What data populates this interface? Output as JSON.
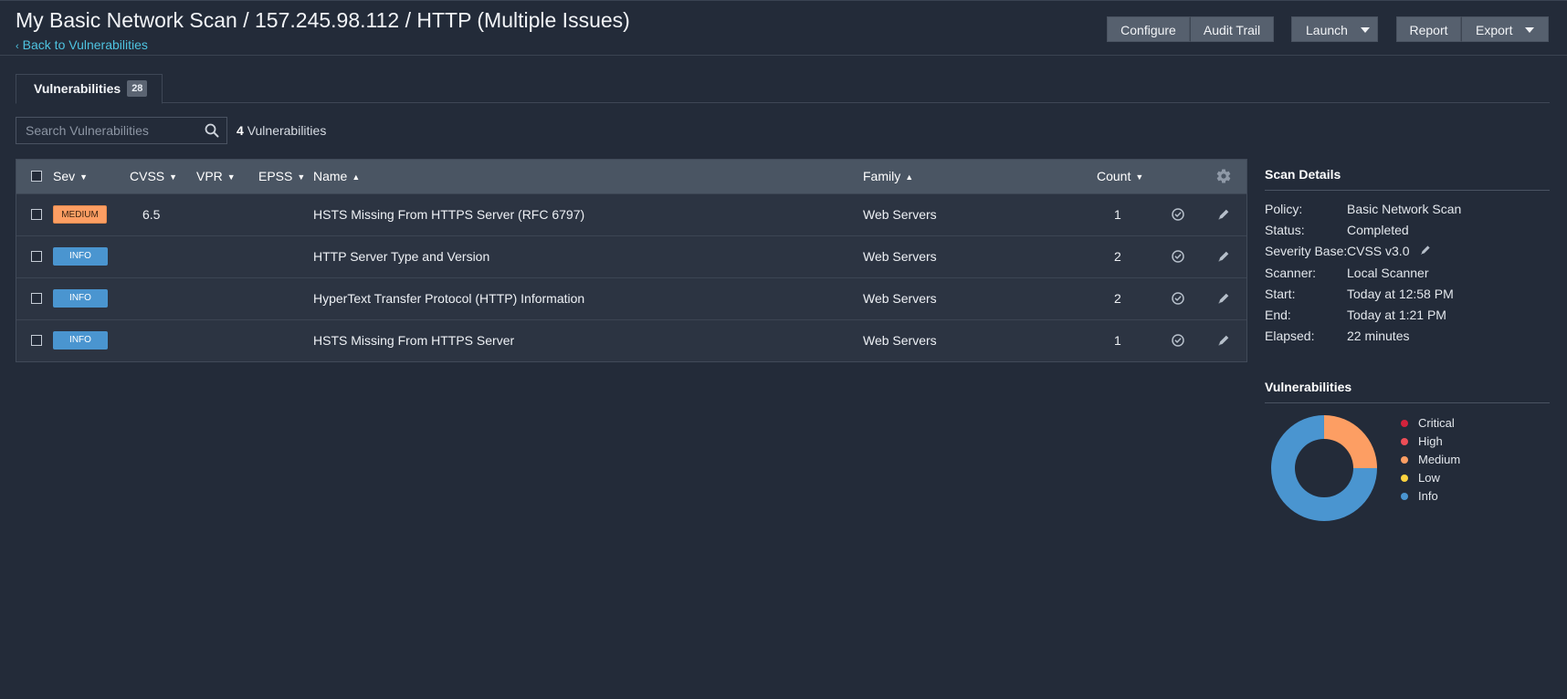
{
  "header": {
    "title": "My Basic Network Scan / 157.245.98.112 / HTTP (Multiple Issues)",
    "back_label": "Back to Vulnerabilities",
    "buttons": {
      "configure": "Configure",
      "audit_trail": "Audit Trail",
      "launch": "Launch",
      "report": "Report",
      "export": "Export"
    }
  },
  "tabs": [
    {
      "label": "Vulnerabilities",
      "badge": "28"
    }
  ],
  "search": {
    "placeholder": "Search Vulnerabilities",
    "value": ""
  },
  "result_count": {
    "number": "4",
    "label": "Vulnerabilities"
  },
  "table": {
    "columns": {
      "sev": "Sev",
      "cvss": "CVSS",
      "vpr": "VPR",
      "epss": "EPSS",
      "name": "Name",
      "family": "Family",
      "count": "Count"
    },
    "sort_arrows": {
      "down": "▼",
      "up": "▲"
    },
    "rows": [
      {
        "severity": "MEDIUM",
        "cvss": "6.5",
        "vpr": "",
        "epss": "",
        "name": "HSTS Missing From HTTPS Server (RFC 6797)",
        "family": "Web Servers",
        "count": "1"
      },
      {
        "severity": "INFO",
        "cvss": "",
        "vpr": "",
        "epss": "",
        "name": "HTTP Server Type and Version",
        "family": "Web Servers",
        "count": "2"
      },
      {
        "severity": "INFO",
        "cvss": "",
        "vpr": "",
        "epss": "",
        "name": "HyperText Transfer Protocol (HTTP) Information",
        "family": "Web Servers",
        "count": "2"
      },
      {
        "severity": "INFO",
        "cvss": "",
        "vpr": "",
        "epss": "",
        "name": "HSTS Missing From HTTPS Server",
        "family": "Web Servers",
        "count": "1"
      }
    ]
  },
  "scan_details": {
    "title": "Scan Details",
    "items": [
      {
        "key": "Policy:",
        "value": "Basic Network Scan"
      },
      {
        "key": "Status:",
        "value": "Completed"
      },
      {
        "key": "Severity Base:",
        "value": "CVSS v3.0"
      },
      {
        "key": "Scanner:",
        "value": "Local Scanner"
      },
      {
        "key": "Start:",
        "value": "Today at 12:58 PM"
      },
      {
        "key": "End:",
        "value": "Today at 1:21 PM"
      },
      {
        "key": "Elapsed:",
        "value": "22 minutes"
      }
    ]
  },
  "vuln_summary": {
    "title": "Vulnerabilities",
    "legend": [
      {
        "label": "Critical",
        "color": "#d2233c"
      },
      {
        "label": "High",
        "color": "#ee4e57"
      },
      {
        "label": "Medium",
        "color": "#fd9e63"
      },
      {
        "label": "Low",
        "color": "#fcd33f"
      },
      {
        "label": "Info",
        "color": "#4a95d0"
      }
    ],
    "donut": {
      "medium_fraction": 0.25,
      "info_fraction": 0.75
    }
  },
  "colors": {
    "background": "#232b39",
    "accent_link": "#4ec3e0",
    "medium": "#fd9e63",
    "info": "#4a95d0"
  },
  "icons": [
    "chevron-left-icon",
    "search-icon",
    "gear-icon",
    "check-circle-icon",
    "pencil-icon",
    "caret-down-icon"
  ]
}
